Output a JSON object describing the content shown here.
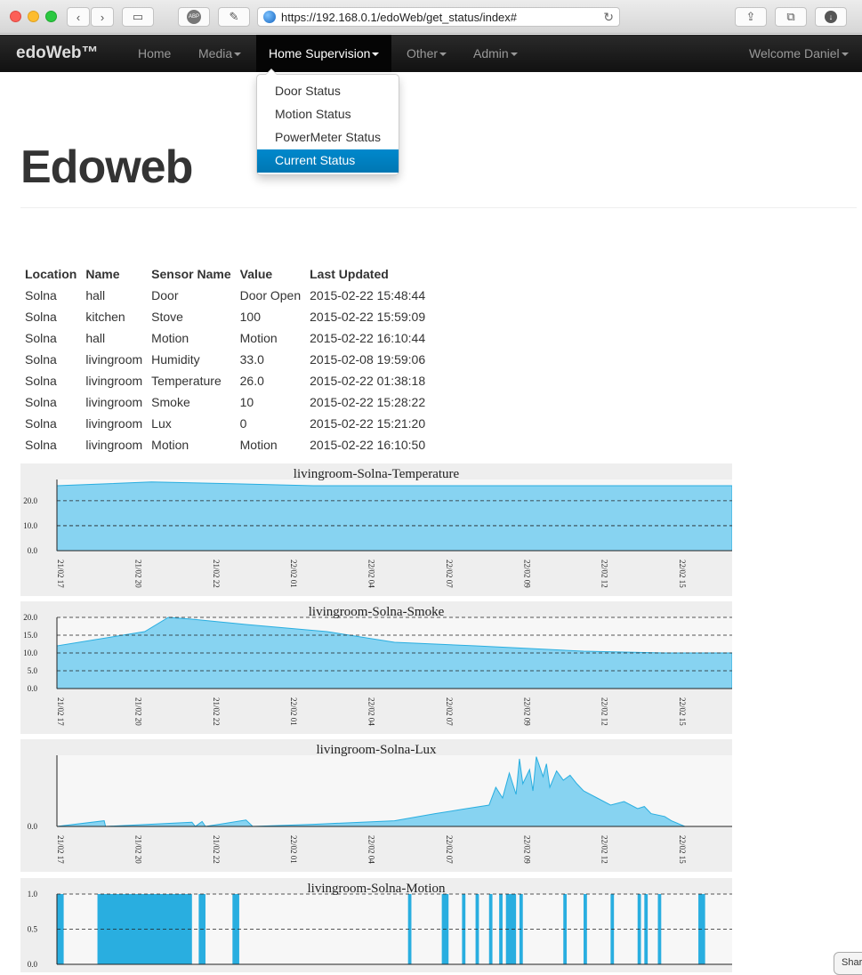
{
  "browser": {
    "url": "https://192.168.0.1/edoWeb/get_status/index#",
    "adblock_label": "ABP",
    "icons": [
      "back-arrow-icon",
      "forward-arrow-icon",
      "sidebar-icon",
      "adblock-icon",
      "evernote-icon",
      "globe-icon",
      "reload-icon",
      "share-icon",
      "tabs-icon",
      "download-icon"
    ]
  },
  "navbar": {
    "brand": "edoWeb™",
    "items": [
      {
        "label": "Home"
      },
      {
        "label": "Media"
      },
      {
        "label": "Home Supervision"
      },
      {
        "label": "Other"
      },
      {
        "label": "Admin"
      }
    ],
    "user": "Welcome Daniel"
  },
  "dropdown": {
    "items": [
      "Door Status",
      "Motion Status",
      "PowerMeter Status",
      "Current Status"
    ],
    "selected": "Current Status"
  },
  "page": {
    "title": "Edoweb"
  },
  "table": {
    "headers": [
      "Location",
      "Name",
      "Sensor Name",
      "Value",
      "Last Updated"
    ],
    "rows": [
      [
        "Solna",
        "hall",
        "Door",
        "Door Open",
        "2015-02-22 15:48:44"
      ],
      [
        "Solna",
        "kitchen",
        "Stove",
        "100",
        "2015-02-22 15:59:09"
      ],
      [
        "Solna",
        "hall",
        "Motion",
        "Motion",
        "2015-02-22 16:10:44"
      ],
      [
        "Solna",
        "livingroom",
        "Humidity",
        "33.0",
        "2015-02-08 19:59:06"
      ],
      [
        "Solna",
        "livingroom",
        "Temperature",
        "26.0",
        "2015-02-22 01:38:18"
      ],
      [
        "Solna",
        "livingroom",
        "Smoke",
        "10",
        "2015-02-22 15:28:22"
      ],
      [
        "Solna",
        "livingroom",
        "Lux",
        "0",
        "2015-02-22 15:21:20"
      ],
      [
        "Solna",
        "livingroom",
        "Motion",
        "Motion",
        "2015-02-22 16:10:50"
      ]
    ]
  },
  "colors": {
    "fill": "#87d3f1",
    "stroke": "#29aee0",
    "plot_bg": "#f7f7f7",
    "panel_bg": "#eeeeee",
    "accent": "#0088cc"
  },
  "share_label": "Shar",
  "chart_data": [
    {
      "type": "area",
      "title": "livingroom-Solna-Temperature",
      "x_ticks": [
        "21/02 17",
        "21/02 20",
        "21/02 22",
        "22/02 01",
        "22/02 04",
        "22/02 07",
        "22/02 09",
        "22/02 12",
        "22/02 15"
      ],
      "y_ticks": [
        "0.0",
        "10.0",
        "20.0"
      ],
      "ylim": [
        0,
        28.5
      ],
      "grid": "dashed-horizontal",
      "x": [
        0,
        0.14,
        0.26,
        0.38,
        0.5,
        0.62,
        0.74,
        0.86,
        1.0
      ],
      "values": [
        26.0,
        27.5,
        26.8,
        26.0,
        26.0,
        26.0,
        26.0,
        26.0,
        26.0
      ]
    },
    {
      "type": "area",
      "title": "livingroom-Solna-Smoke",
      "x_ticks": [
        "21/02 17",
        "21/02 20",
        "21/02 22",
        "22/02 01",
        "22/02 04",
        "22/02 07",
        "22/02 09",
        "22/02 12",
        "22/02 15"
      ],
      "y_ticks": [
        "0.0",
        "5.0",
        "10.0",
        "15.0",
        "20.0"
      ],
      "ylim": [
        0,
        20
      ],
      "grid": "dashed-horizontal",
      "x": [
        0,
        0.13,
        0.165,
        0.2,
        0.28,
        0.4,
        0.5,
        0.62,
        0.78,
        0.9,
        1.0
      ],
      "values": [
        12,
        16,
        20,
        19.5,
        18,
        16,
        13,
        12,
        10.5,
        10,
        10
      ]
    },
    {
      "type": "area",
      "title": "livingroom-Solna-Lux",
      "x_ticks": [
        "21/02 17",
        "21/02 20",
        "21/02 22",
        "22/02 01",
        "22/02 04",
        "22/02 07",
        "22/02 09",
        "22/02 12",
        "22/02 15"
      ],
      "y_ticks": [
        "0.0"
      ],
      "ylim": [
        0,
        100
      ],
      "grid": "none",
      "x": [
        0,
        0.07,
        0.072,
        0.2,
        0.205,
        0.215,
        0.22,
        0.28,
        0.29,
        0.38,
        0.5,
        0.56,
        0.6,
        0.64,
        0.65,
        0.66,
        0.67,
        0.68,
        0.685,
        0.69,
        0.7,
        0.705,
        0.71,
        0.72,
        0.725,
        0.73,
        0.74,
        0.75,
        0.76,
        0.77,
        0.78,
        0.8,
        0.82,
        0.84,
        0.86,
        0.87,
        0.88,
        0.9,
        0.91,
        0.93,
        1.0
      ],
      "values": [
        0,
        8,
        0,
        6,
        0,
        7,
        0,
        9,
        0,
        3,
        8,
        18,
        24,
        30,
        55,
        40,
        75,
        45,
        95,
        60,
        80,
        50,
        98,
        70,
        88,
        55,
        78,
        65,
        72,
        60,
        50,
        40,
        30,
        35,
        25,
        28,
        18,
        14,
        8,
        0,
        0
      ]
    },
    {
      "type": "bar",
      "title": "livingroom-Solna-Motion",
      "y_ticks": [
        "0.0",
        "0.5",
        "1.0"
      ],
      "ylim": [
        0,
        1
      ],
      "grid": "dashed-horizontal",
      "on_intervals": [
        [
          0.0,
          0.01
        ],
        [
          0.06,
          0.2
        ],
        [
          0.21,
          0.22
        ],
        [
          0.26,
          0.27
        ],
        [
          0.52,
          0.525
        ],
        [
          0.57,
          0.58
        ],
        [
          0.6,
          0.605
        ],
        [
          0.62,
          0.625
        ],
        [
          0.64,
          0.645
        ],
        [
          0.655,
          0.66
        ],
        [
          0.665,
          0.68
        ],
        [
          0.685,
          0.69
        ],
        [
          0.75,
          0.755
        ],
        [
          0.78,
          0.785
        ],
        [
          0.82,
          0.825
        ],
        [
          0.86,
          0.865
        ],
        [
          0.87,
          0.875
        ],
        [
          0.89,
          0.895
        ],
        [
          0.95,
          0.96
        ]
      ]
    }
  ]
}
